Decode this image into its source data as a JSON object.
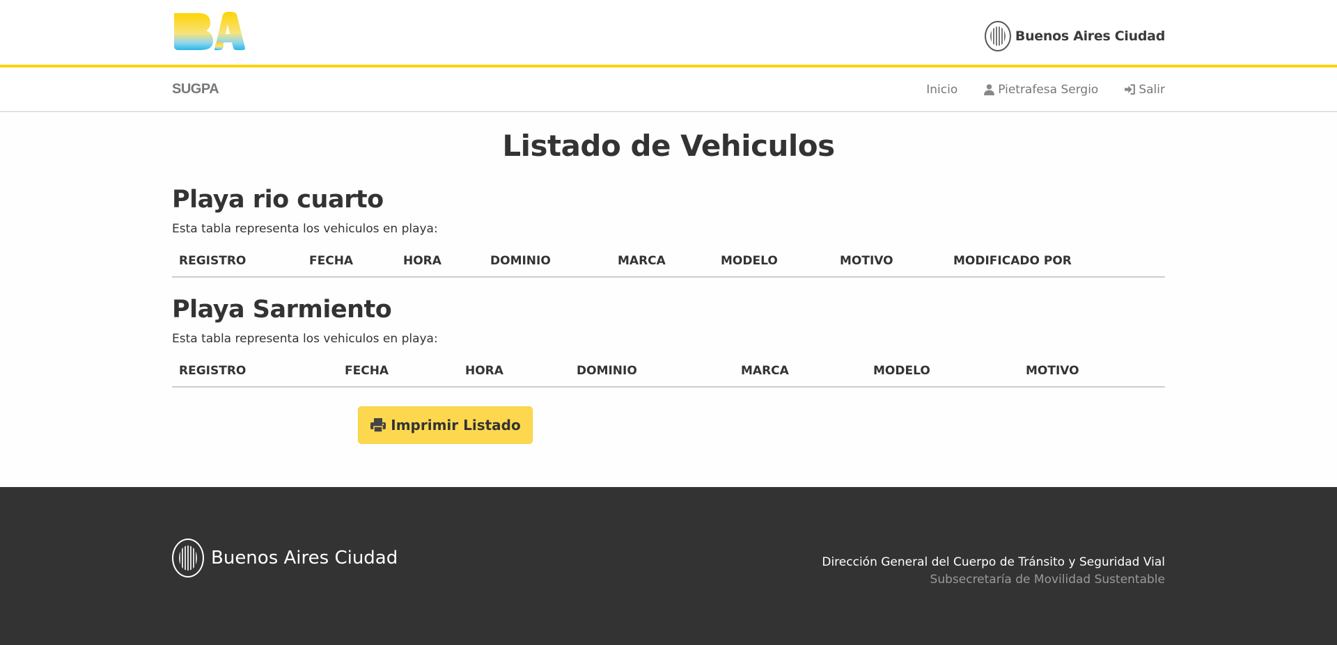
{
  "header": {
    "brand_right": "Buenos Aires Ciudad",
    "logo_colors": {
      "top": "#fdd306",
      "bottom": "#2bb7e6"
    }
  },
  "nav": {
    "brand": "SUGPA",
    "links": [
      {
        "label": "Inicio",
        "icon": ""
      },
      {
        "label": "Pietrafesa Sergio",
        "icon": "user-icon"
      },
      {
        "label": "Salir",
        "icon": "sign-in-icon"
      }
    ]
  },
  "main": {
    "title": "Listado de Vehiculos",
    "sections": [
      {
        "title": "Playa rio cuarto",
        "caption": "Esta tabla representa los vehiculos en playa:",
        "columns": [
          "REGISTRO",
          "FECHA",
          "HORA",
          "DOMINIO",
          "MARCA",
          "MODELO",
          "MOTIVO",
          "MODIFICADO POR"
        ]
      },
      {
        "title": "Playa Sarmiento",
        "caption": "Esta tabla representa los vehiculos en playa:",
        "columns": [
          "REGISTRO",
          "FECHA",
          "HORA",
          "DOMINIO",
          "MARCA",
          "MODELO",
          "MOTIVO"
        ]
      }
    ],
    "print_button": "Imprimir Listado"
  },
  "footer": {
    "brand": "Buenos Aires Ciudad",
    "line1": "Dirección General del Cuerpo de Tránsito y Seguridad Vial",
    "line2": "Subsecretaría de Movilidad Sustentable"
  },
  "colors": {
    "accent_yellow": "#fdd306",
    "button_yellow": "#fdd84e",
    "footer_bg": "#333333"
  }
}
